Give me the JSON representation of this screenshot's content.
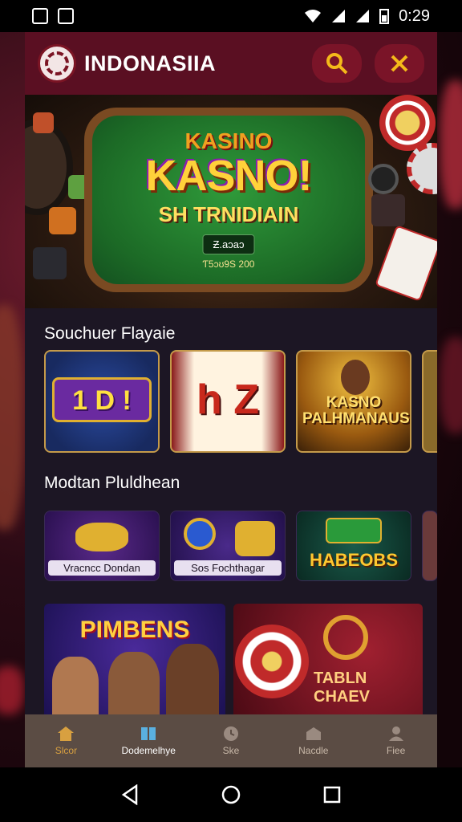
{
  "status_bar": {
    "time": "0:29"
  },
  "header": {
    "title": "INDONASIIA"
  },
  "hero": {
    "subtitle_top": "KASINO",
    "title": "KASNO!",
    "subtitle": "SH TRNIDIAIN",
    "pill": "Ƶ.aɔaɔ",
    "small": "Ƭ5ɔʊ9S 200"
  },
  "sections": {
    "popular_title": "Souchuer Flayaie",
    "promo_title": "Modtan Pluldhean"
  },
  "games": [
    {
      "label": "1 D !"
    },
    {
      "label": "h Z"
    },
    {
      "label": "KASNO PALHMANAUS"
    }
  ],
  "promos": [
    {
      "label": "Vracncc Dondan"
    },
    {
      "label": "Sos Fochthagar"
    },
    {
      "label": "HABEOBS"
    }
  ],
  "featured": [
    {
      "label": "PIMBENS"
    },
    {
      "label": "TABLN CHAEV"
    }
  ],
  "bottom_nav": [
    {
      "label": "Slcor",
      "icon": "home-icon"
    },
    {
      "label": "Dodemelhye",
      "icon": "book-icon"
    },
    {
      "label": "Ske",
      "icon": "clock-icon"
    },
    {
      "label": "Nacdle",
      "icon": "shop-icon"
    },
    {
      "label": "Fiee",
      "icon": "user-icon"
    }
  ],
  "colors": {
    "header": "#5a0f22",
    "accent": "#f4b91a",
    "nav_bg": "#5b4c44",
    "app_bg": "#1c1624"
  }
}
